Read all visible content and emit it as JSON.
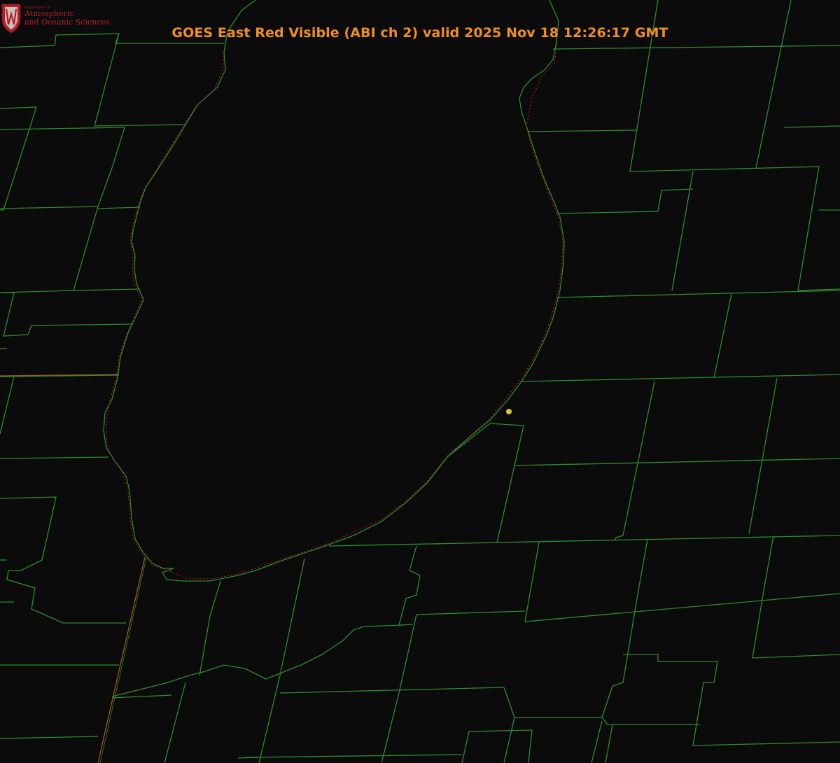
{
  "title": "GOES East Red Visible (ABI ch 2) valid 2025 Nov 18 12:26:17 GMT",
  "logo": {
    "line1": "Department of",
    "line2": "Atmospheric",
    "line3": "and Oceanic Sciences"
  },
  "colors": {
    "background": "#0b0b0b",
    "county_lines": "#2f8a2f",
    "coastline": "#c81e1e",
    "state_border": "#b05a1e",
    "marker": "#d2c83c",
    "title": "#f0901c",
    "logo": "#b41e2a"
  }
}
